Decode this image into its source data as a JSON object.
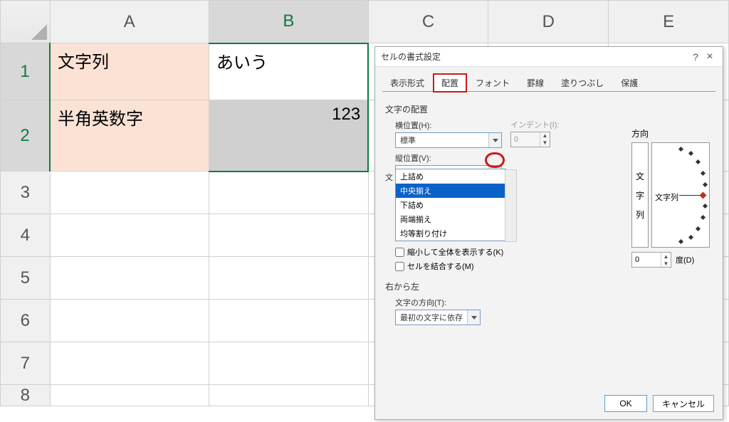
{
  "sheet": {
    "cols": [
      "A",
      "B",
      "C",
      "D",
      "E"
    ],
    "rows": [
      "1",
      "2",
      "3",
      "4",
      "5",
      "6",
      "7",
      "8"
    ],
    "cells": {
      "a1": "文字列",
      "b1": "あいう",
      "a2": "半角英数字",
      "b2": "123"
    }
  },
  "dialog": {
    "title": "セルの書式設定",
    "tabs": [
      "表示形式",
      "配置",
      "フォント",
      "罫線",
      "塗りつぶし",
      "保護"
    ],
    "group_align": "文字の配置",
    "h_label": "横位置(H):",
    "h_value": "標準",
    "indent_label": "インデント(I):",
    "indent_value": "0",
    "v_label": "縦位置(V):",
    "v_value": "上詰め",
    "v_options": [
      "上詰め",
      "中央揃え",
      "下詰め",
      "両端揃え",
      "均等割り付け"
    ],
    "text_control_hidden": "文",
    "chk_shrink": "縮小して全体を表示する(K)",
    "chk_merge": "セルを結合する(M)",
    "group_rtl": "右から左",
    "dir_label": "文字の方向(T):",
    "dir_value": "最初の文字に依存",
    "orient_label": "方向",
    "vert_text": [
      "文",
      "字",
      "列"
    ],
    "arc_text": "文字列",
    "deg_value": "0",
    "deg_label": "度(D)",
    "ok": "OK",
    "cancel": "キャンセル"
  }
}
